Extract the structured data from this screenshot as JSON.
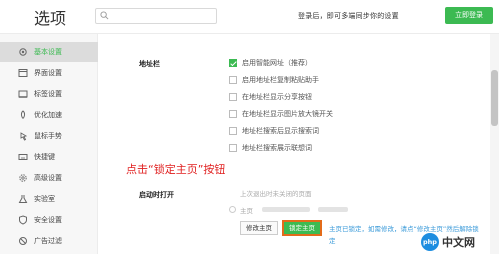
{
  "header": {
    "title": "选项",
    "search_placeholder": "",
    "login_hint": "登录后，即可多端同步你的设置",
    "login_button": "立即登录"
  },
  "sidebar": {
    "items": [
      {
        "label": "基本设置",
        "icon": "gear-icon",
        "active": true
      },
      {
        "label": "界面设置",
        "icon": "window-icon"
      },
      {
        "label": "标签设置",
        "icon": "tab-icon"
      },
      {
        "label": "优化加速",
        "icon": "rocket-icon"
      },
      {
        "label": "鼠标手势",
        "icon": "mouse-icon"
      },
      {
        "label": "快捷键",
        "icon": "keyboard-icon"
      },
      {
        "label": "高级设置",
        "icon": "advanced-gear-icon"
      },
      {
        "label": "实验室",
        "icon": "lab-icon"
      },
      {
        "label": "安全设置",
        "icon": "shield-icon"
      },
      {
        "label": "广告过滤",
        "icon": "block-icon"
      }
    ]
  },
  "address_bar": {
    "label": "地址栏",
    "options": [
      {
        "label": "启用智能网址（推荐）",
        "checked": true
      },
      {
        "label": "启用地址栏复制粘贴助手",
        "checked": false
      },
      {
        "label": "在地址栏显示分享按钮",
        "checked": false
      },
      {
        "label": "在地址栏显示图片放大镜开关",
        "checked": false
      },
      {
        "label": "地址栏搜索后显示搜索词",
        "checked": false
      },
      {
        "label": "地址栏搜索展示联想词",
        "checked": false
      }
    ]
  },
  "annotation": "点击“锁定主页”按钮",
  "startup": {
    "label": "启动时打开",
    "option1": "上次退出时未关闭的页面",
    "option2": "主页",
    "modify_button": "修改主页",
    "lock_button": "锁定主页",
    "lock_note": "主页已锁定，如需修改，请点“修改主页”然后解除锁定"
  },
  "watermark": {
    "logo": "php",
    "text": "中文网"
  },
  "colors": {
    "accent": "#3cba52",
    "annotation": "#e02020",
    "highlight_border": "#e36b1a",
    "link": "#3a9ad9"
  }
}
